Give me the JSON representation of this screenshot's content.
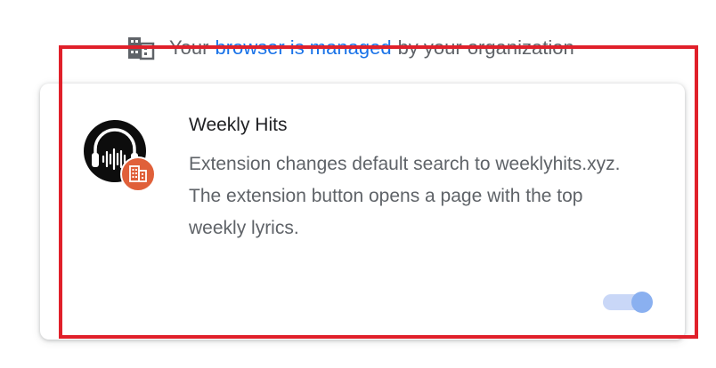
{
  "banner": {
    "prefix": "Your",
    "link_text": "browser is managed",
    "suffix": "by your organization",
    "icon": "building-icon",
    "link_color": "#1a73e8"
  },
  "extension": {
    "name": "Weekly Hits",
    "description": "Extension changes default search to weeklyhits.xyz. The extension button opens a page with the top weekly lyrics.",
    "logo_icon": "headphones-soundwave-icon",
    "badge_icon": "enterprise-building-icon",
    "badge_color": "#e0603a",
    "enabled": true,
    "toggle_color": "#8ab0f0"
  },
  "highlight": {
    "color": "#e0202a"
  }
}
